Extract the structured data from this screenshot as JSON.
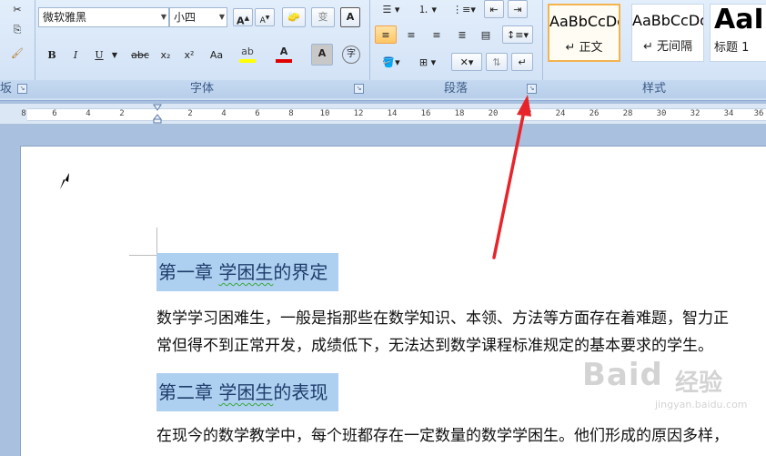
{
  "font_group": {
    "label": "字体",
    "font_name": "微软雅黑",
    "font_size": "小四",
    "buttons": {
      "bold": "B",
      "italic": "I",
      "underline": "U",
      "strike": "abc",
      "subscript": "x₂",
      "superscript": "x²",
      "change_case": "Aa",
      "grow": "A",
      "shrink": "A",
      "clear": "A",
      "phonetic": "字"
    }
  },
  "paragraph_group": {
    "label": "段落"
  },
  "styles_group": {
    "label": "样式",
    "items": [
      {
        "sample": "AaBbCcDc",
        "name": "↵ 正文"
      },
      {
        "sample": "AaBbCcDc",
        "name": "↵ 无间隔"
      },
      {
        "sample": "AaI",
        "name": "标题 1"
      }
    ]
  },
  "clipboard_group": {
    "label_fragment": "坂"
  },
  "ruler": {
    "labels": [
      "8",
      "6",
      "4",
      "2",
      "2",
      "4",
      "6",
      "8",
      "10",
      "12",
      "14",
      "16",
      "18",
      "20",
      "22",
      "24",
      "26",
      "28",
      "30",
      "32",
      "34",
      "36"
    ]
  },
  "document": {
    "headings": [
      {
        "number": "第一章 ",
        "underlined": "学困生",
        "rest": "的界定"
      },
      {
        "number": "第二章 ",
        "underlined": "学困生",
        "rest": "的表现"
      }
    ],
    "paragraphs": [
      "数学学习困难生，一般是指那些在数学知识、本领、方法等方面存在着难题，智力正",
      "常但得不到正常开发，成绩低下，无法达到数学课程标准规定的基本要求的学生。",
      "在现今的数学教学中，每个班都存在一定数量的数学学困生。他们形成的原因多样，"
    ]
  },
  "watermark": {
    "logo": "Baid",
    "cn": "经验",
    "url": "jingyan.baidu.com"
  },
  "colors": {
    "selection": "#add0f0",
    "arrow": "#e8242b",
    "accent": "#f3b34f"
  }
}
